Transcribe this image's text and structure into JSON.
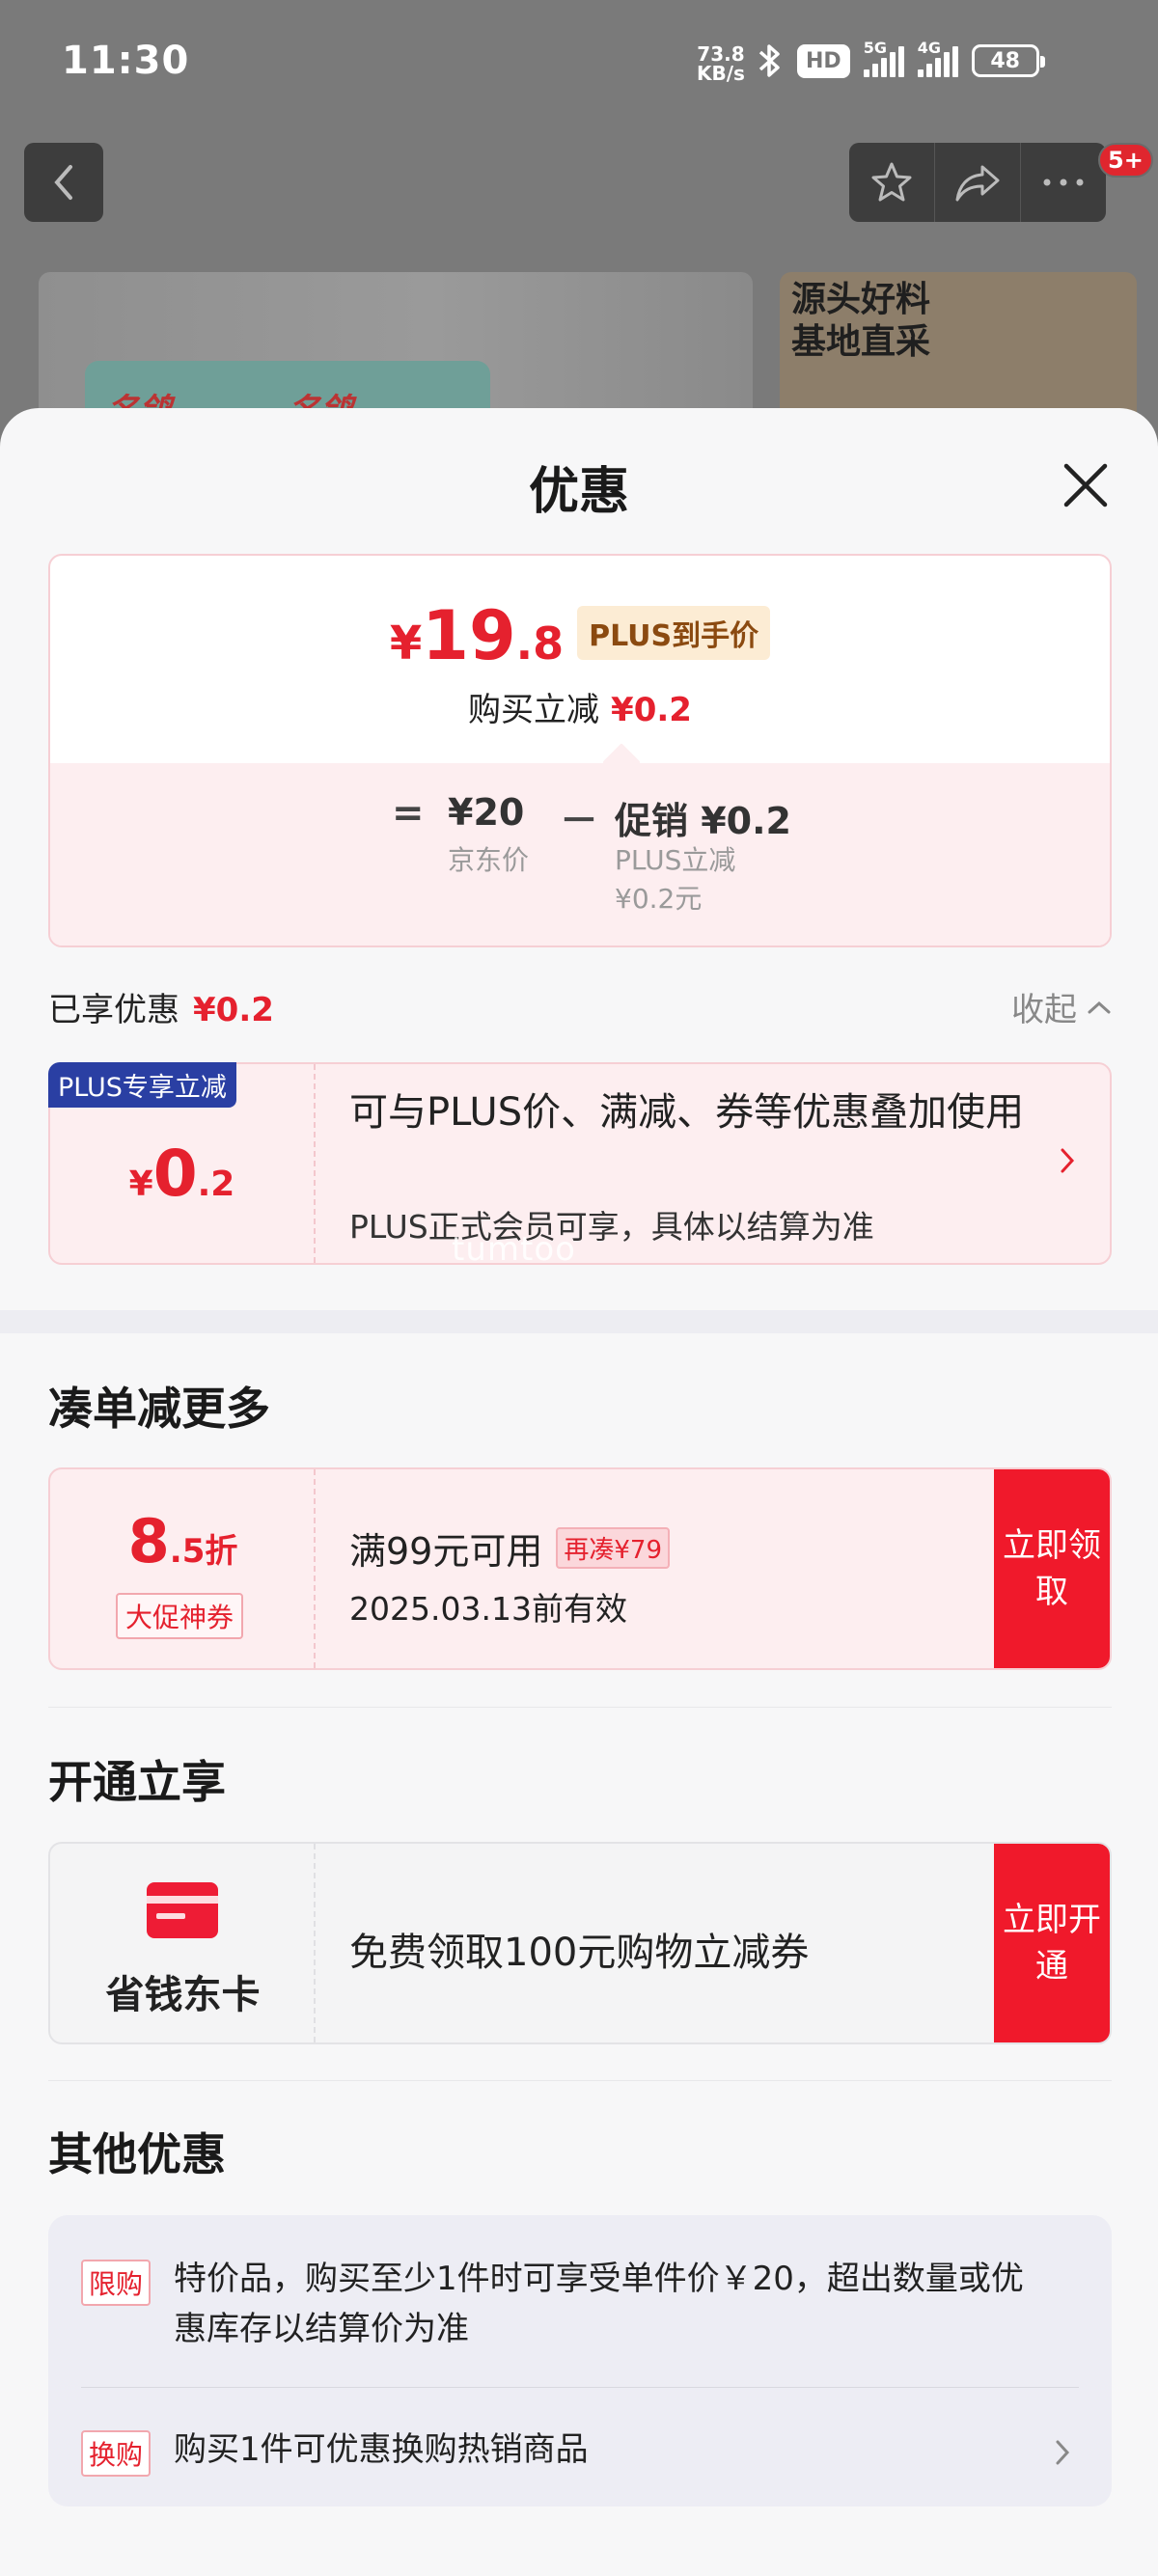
{
  "status_bar": {
    "time": "11:30",
    "net_speed_value": "73.8",
    "net_speed_unit": "KB/s",
    "hd_label": "HD",
    "sim1_label": "5G",
    "sim2_label": "4G",
    "battery": "48"
  },
  "background_page": {
    "notification_badge": "5+",
    "brand_text_1": "名鸽",
    "brand_text_2": "名鸽",
    "promo_line_1": "源头好料",
    "promo_line_2": "基地直采"
  },
  "sheet": {
    "title": "优惠",
    "price_summary": {
      "currency": "¥",
      "final_price_int": "19",
      "final_price_dec": ".8",
      "final_label": "PLUS到手价",
      "reduce_label": "购买立减",
      "reduce_amount": "¥0.2",
      "equals": "=",
      "jd_price": "¥20",
      "jd_price_label": "京东价",
      "minus": "－",
      "promo_value": "促销 ¥0.2",
      "promo_detail_1": "PLUS立减",
      "promo_detail_2": "¥0.2元"
    },
    "enjoyed": {
      "label": "已享优惠",
      "amount": "¥0.2",
      "collapse_label": "收起"
    },
    "plus_card": {
      "ribbon": "PLUS专享立减",
      "currency": "¥",
      "amount_int": "0",
      "amount_dec": ".2",
      "main_text": "可与PLUS价、满减、券等优惠叠加使用",
      "sub_text": "PLUS正式会员可享，具体以结算为准",
      "watermark": "tumtoo"
    },
    "more_section": {
      "title": "凑单减更多",
      "coupon": {
        "discount_int": "8",
        "discount_dec": ".5",
        "discount_unit": "折",
        "tag": "大促神券",
        "condition": "满99元可用",
        "gap_tag": "再凑¥79",
        "validity": "2025.03.13前有效",
        "button": "立即领取"
      }
    },
    "open_section": {
      "title": "开通立享",
      "card": {
        "name": "省钱东卡",
        "description": "免费领取100元购物立减券",
        "button": "立即开通"
      }
    },
    "other_section": {
      "title": "其他优惠",
      "items": [
        {
          "tag": "限购",
          "text": "特价品，购买至少1件时可享受单件价￥20，超出数量或优惠库存以结算价为准"
        },
        {
          "tag": "换购",
          "text": "购买1件可优惠换购热销商品"
        }
      ]
    }
  },
  "colors": {
    "accent_red": "#e5212e",
    "button_red": "#f0192b",
    "plus_blue": "#2a3fa3"
  }
}
